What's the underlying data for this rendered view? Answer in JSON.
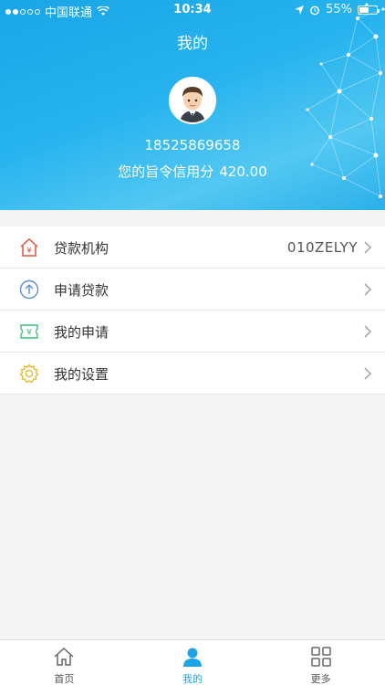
{
  "status_bar": {
    "carrier": "中国联通",
    "time": "10:34",
    "battery": "55%",
    "battery_level": 0.55
  },
  "header": {
    "title": "我的",
    "phone": "18525869658",
    "credit_label": "您的旨令信用分",
    "credit_score": "420.00"
  },
  "menu": [
    {
      "label": "贷款机构",
      "value": "010ZELYY",
      "icon": "house-yen-icon",
      "color": "#e0533f"
    },
    {
      "label": "申请贷款",
      "value": "",
      "icon": "arrow-up-circle-icon",
      "color": "#5b8fd9"
    },
    {
      "label": "我的申请",
      "value": "",
      "icon": "yen-ticket-icon",
      "color": "#3fbf7f"
    },
    {
      "label": "我的设置",
      "value": "",
      "icon": "gear-icon",
      "color": "#e8b323"
    }
  ],
  "tabbar": {
    "items": [
      {
        "label": "首页",
        "icon": "home-icon",
        "active": false
      },
      {
        "label": "我的",
        "icon": "user-icon",
        "active": true
      },
      {
        "label": "更多",
        "icon": "grid-icon",
        "active": false
      }
    ],
    "accent": "#1ea3e6"
  }
}
